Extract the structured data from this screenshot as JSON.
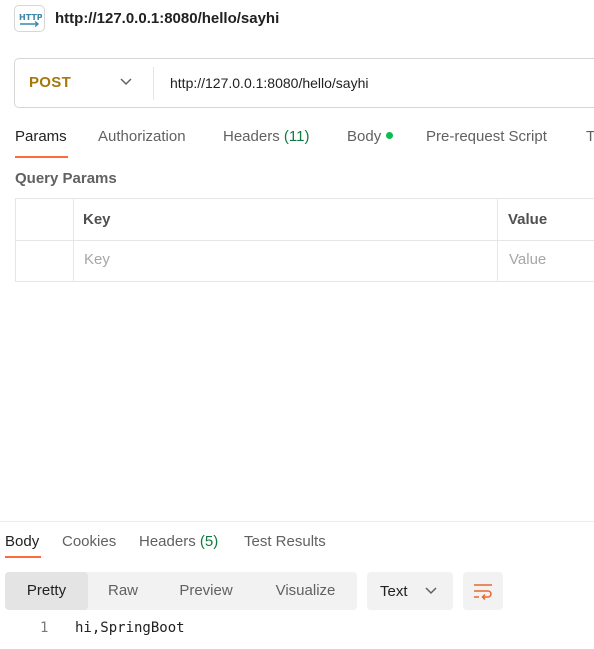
{
  "title": {
    "url": "http://127.0.0.1:8080/hello/sayhi",
    "icon": "http-icon"
  },
  "request": {
    "method": "POST",
    "url": "http://127.0.0.1:8080/hello/sayhi",
    "method_color": "#a6770a"
  },
  "request_tabs": {
    "params": "Params",
    "authorization": "Authorization",
    "headers": "Headers",
    "headers_count": "(11)",
    "body": "Body",
    "prerequest": "Pre-request Script",
    "tests": "Tests",
    "active": "Params"
  },
  "query_params": {
    "label": "Query Params",
    "headers": {
      "key": "Key",
      "value": "Value"
    },
    "placeholders": {
      "key": "Key",
      "value": "Value"
    }
  },
  "response_tabs": {
    "body": "Body",
    "cookies": "Cookies",
    "headers": "Headers",
    "headers_count": "(5)",
    "test_results": "Test Results",
    "active": "Body"
  },
  "view_modes": {
    "pretty": "Pretty",
    "raw": "Raw",
    "preview": "Preview",
    "visualize": "Visualize",
    "active": "Pretty"
  },
  "format": {
    "selected": "Text"
  },
  "response_body": {
    "lines": [
      {
        "number": "1",
        "text": "hi,SpringBoot"
      }
    ]
  },
  "colors": {
    "accent": "#ff6c37",
    "status_dot": "#0cbb52",
    "count": "#0f7b3f"
  }
}
